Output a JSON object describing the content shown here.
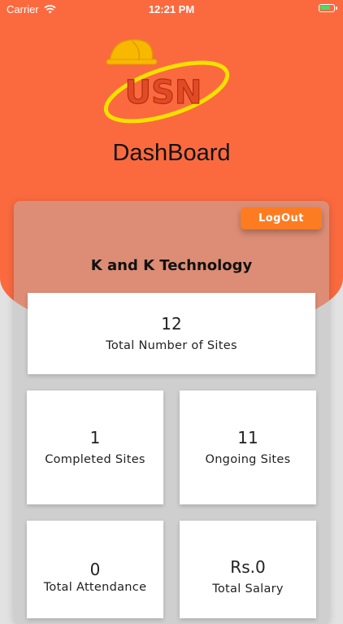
{
  "status_bar": {
    "carrier": "Carrier",
    "time": "12:21 PM"
  },
  "logo": {
    "text": "USN"
  },
  "header": {
    "title": "DashBoard"
  },
  "actions": {
    "logout_label": "LogOut"
  },
  "company": {
    "name": "K and K Technology"
  },
  "stats": [
    {
      "value": "12",
      "label": "Total Number of Sites"
    },
    {
      "value": "1",
      "label": "Completed Sites"
    },
    {
      "value": "11",
      "label": "Ongoing Sites"
    },
    {
      "value": "0",
      "label": "Total Attendance"
    },
    {
      "value": "Rs.0",
      "label": "Total Salary"
    }
  ],
  "colors": {
    "brand": "#fb6a3f",
    "button": "#fd7c22",
    "logo_yellow": "#f5e000",
    "battery": "#4cd964"
  }
}
